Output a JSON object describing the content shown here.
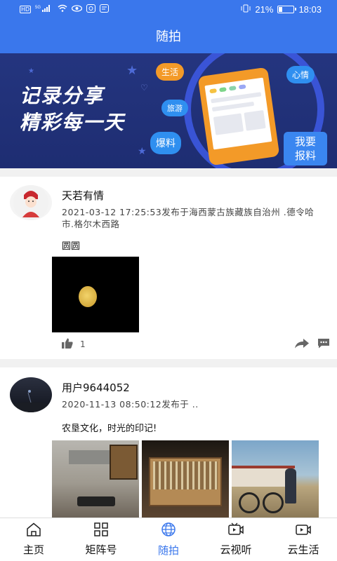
{
  "status_bar": {
    "left_icons": [
      "HD",
      "5G",
      "signal",
      "wifi",
      "eye",
      "app",
      "chat"
    ],
    "battery_percent": "21%",
    "time": "18:03"
  },
  "title": "随拍",
  "banner": {
    "headline_line1": "记录分享",
    "headline_line2": "精彩每一天",
    "bubbles": [
      "生活",
      "心情",
      "旅游",
      "爆料"
    ],
    "cta_line1": "我要",
    "cta_line2": "报料"
  },
  "posts": [
    {
      "username": "天若有情",
      "meta": "2021-03-12  17:25:53发布于海西蒙古族藏族自治州  .德令哈市.格尔木西路",
      "text": "圆圆",
      "likes": "1"
    },
    {
      "username": "用户9644052",
      "meta": "2020-11-13  08:50:12发布于  ..",
      "text": "农垦文化，时光的印记!"
    }
  ],
  "tabbar": {
    "items": [
      {
        "label": "主页",
        "icon": "home-icon"
      },
      {
        "label": "矩阵号",
        "icon": "grid-icon"
      },
      {
        "label": "随拍",
        "icon": "globe-icon",
        "active": true
      },
      {
        "label": "云视听",
        "icon": "tv-icon"
      },
      {
        "label": "云生活",
        "icon": "video-icon"
      }
    ]
  },
  "colors": {
    "accent": "#3a77ec",
    "banner_bg": "#24357f",
    "orange": "#f39a28"
  }
}
